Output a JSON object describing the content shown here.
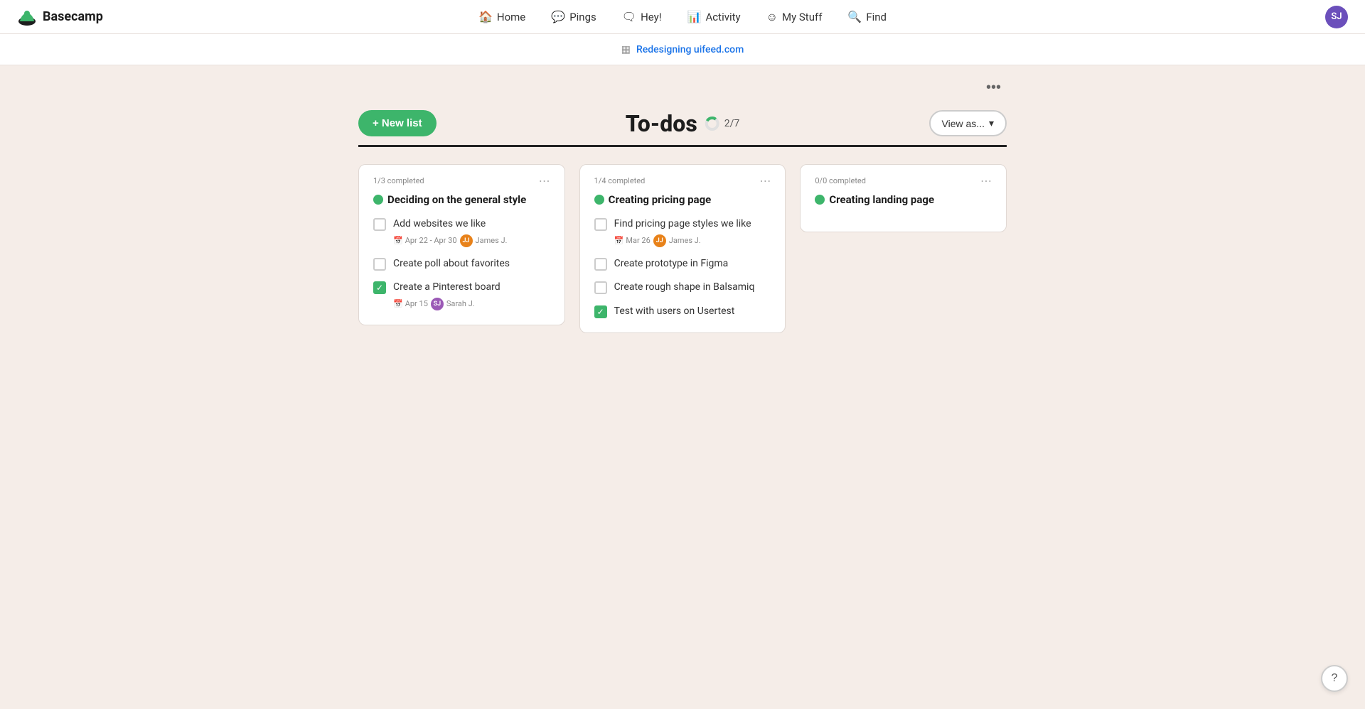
{
  "app": {
    "logo": "Basecamp",
    "logo_icon": "🏕"
  },
  "nav": {
    "items": [
      {
        "label": "Home",
        "icon": "🏠"
      },
      {
        "label": "Pings",
        "icon": "💬"
      },
      {
        "label": "Hey!",
        "icon": "🗨"
      },
      {
        "label": "Activity",
        "icon": "📊"
      },
      {
        "label": "My Stuff",
        "icon": "☺"
      },
      {
        "label": "Find",
        "icon": "🔍"
      }
    ],
    "avatar_initials": "SJ",
    "avatar_color": "#6b4fbb"
  },
  "project_bar": {
    "project_name": "Redesigning uifeed.com"
  },
  "page": {
    "title": "To-dos",
    "progress_label": "2/7",
    "new_list_label": "+ New list",
    "view_as_label": "View as...",
    "options_icon": "•••"
  },
  "todo_lists": [
    {
      "id": "list-1",
      "completed_label": "1/3 completed",
      "title": "Deciding on the general style",
      "items": [
        {
          "checked": false,
          "text": "Add websites we like",
          "date": "Apr 22 - Apr 30",
          "assignee": "James J.",
          "assignee_color": "#e8821a",
          "assignee_initials": "JJ"
        },
        {
          "checked": false,
          "text": "Create poll about favorites",
          "date": null,
          "assignee": null
        },
        {
          "checked": true,
          "text": "Create a Pinterest board",
          "date": "Apr 15",
          "assignee": "Sarah J.",
          "assignee_color": "#9b59b6",
          "assignee_initials": "SJ"
        }
      ]
    },
    {
      "id": "list-2",
      "completed_label": "1/4 completed",
      "title": "Creating pricing page",
      "items": [
        {
          "checked": false,
          "text": "Find pricing page styles we like",
          "date": "Mar 26",
          "assignee": "James J.",
          "assignee_color": "#e8821a",
          "assignee_initials": "JJ"
        },
        {
          "checked": false,
          "text": "Create prototype in Figma",
          "date": null,
          "assignee": null
        },
        {
          "checked": false,
          "text": "Create rough shape in Balsamiq",
          "date": null,
          "assignee": null
        },
        {
          "checked": true,
          "text": "Test with users on Usertest",
          "date": null,
          "assignee": null
        }
      ]
    },
    {
      "id": "list-3",
      "completed_label": "0/0 completed",
      "title": "Creating landing page",
      "items": []
    }
  ],
  "help": {
    "label": "?"
  }
}
